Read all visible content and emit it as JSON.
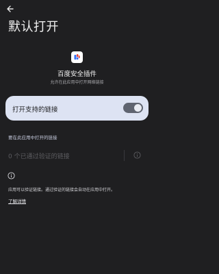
{
  "header": {
    "back_icon": "arrow-left-icon",
    "title": "默认打开"
  },
  "app": {
    "icon": "baidu-security-plugin-icon",
    "name": "百度安全插件",
    "description": "允许在此应用中打开网络链接"
  },
  "toggle": {
    "label": "打开支持的链接",
    "enabled": true
  },
  "links_section": {
    "header": "要在此应用中打开的链接",
    "verified_links_text": "0 个已通过验证的链接",
    "info_icon": "info-icon"
  },
  "footer": {
    "info_icon": "info-icon",
    "text": "应用可以验证链接。通过验证的链接会自动在应用中打开。",
    "learn_more": "了解详情"
  },
  "colors": {
    "background": "#1f1f21",
    "card": "#dde3f3",
    "switch_track": "#5f6470",
    "switch_knob": "#e9ecf3"
  }
}
